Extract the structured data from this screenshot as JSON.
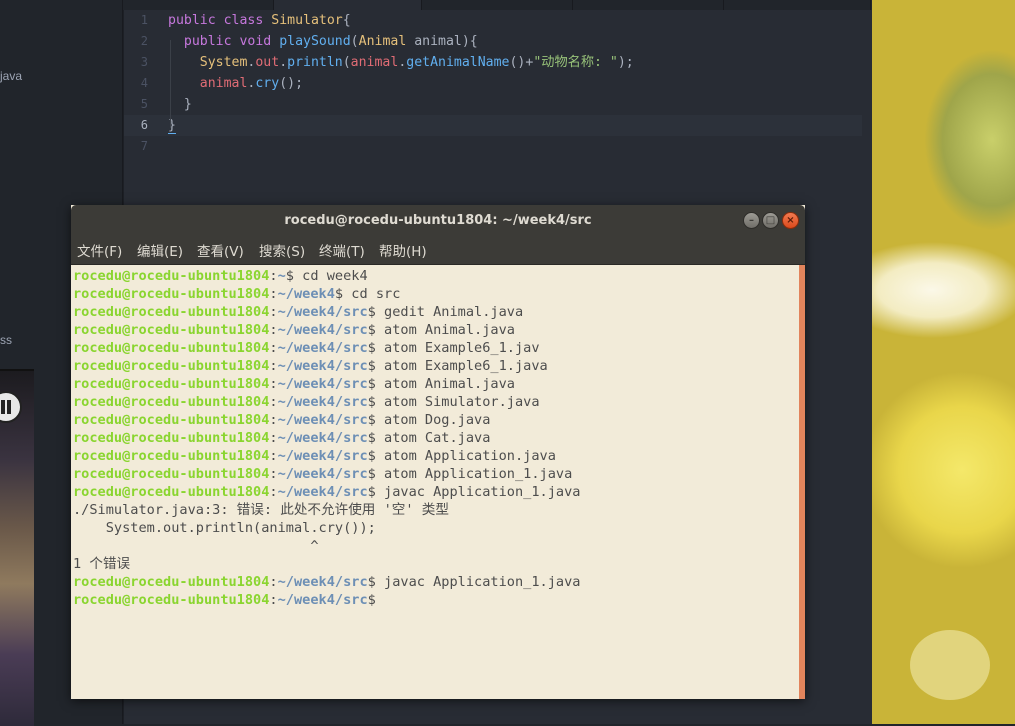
{
  "sidebar": {
    "items": [
      {
        "label": "java"
      },
      {
        "label": "ss"
      }
    ]
  },
  "editor": {
    "lines": [
      {
        "num": "1",
        "tokens": [
          [
            "kw",
            "public"
          ],
          [
            "pun",
            " "
          ],
          [
            "kw",
            "class"
          ],
          [
            "pun",
            " "
          ],
          [
            "cls",
            "Simulator"
          ],
          [
            "pun",
            "{"
          ]
        ]
      },
      {
        "num": "2",
        "tokens": [
          [
            "pun",
            "  "
          ],
          [
            "kw",
            "public"
          ],
          [
            "pun",
            " "
          ],
          [
            "kw",
            "void"
          ],
          [
            "pun",
            " "
          ],
          [
            "fn",
            "playSound"
          ],
          [
            "pun",
            "("
          ],
          [
            "cls",
            "Animal"
          ],
          [
            "pun",
            " animal){"
          ]
        ]
      },
      {
        "num": "3",
        "tokens": [
          [
            "pun",
            "    "
          ],
          [
            "cls",
            "System"
          ],
          [
            "pun",
            "."
          ],
          [
            "var",
            "out"
          ],
          [
            "pun",
            "."
          ],
          [
            "fn",
            "println"
          ],
          [
            "pun",
            "("
          ],
          [
            "var",
            "animal"
          ],
          [
            "pun",
            "."
          ],
          [
            "fn",
            "getAnimalName"
          ],
          [
            "pun",
            "()+"
          ],
          [
            "str",
            "\"动物名称: \""
          ],
          [
            "pun",
            ");"
          ]
        ]
      },
      {
        "num": "4",
        "tokens": [
          [
            "pun",
            "    "
          ],
          [
            "var",
            "animal"
          ],
          [
            "pun",
            "."
          ],
          [
            "fn",
            "cry"
          ],
          [
            "pun",
            "();"
          ]
        ]
      },
      {
        "num": "5",
        "tokens": [
          [
            "pun",
            "  }"
          ]
        ]
      },
      {
        "num": "6",
        "tokens": [
          [
            "brace",
            "}"
          ]
        ]
      },
      {
        "num": "7",
        "tokens": []
      }
    ]
  },
  "terminal": {
    "title": "rocedu@rocedu-ubuntu1804: ~/week4/src",
    "buttons": {
      "minimize": "–",
      "maximize": "□",
      "close": "×"
    },
    "menu": [
      "文件(F)",
      "编辑(E)",
      "查看(V)",
      "搜索(S)",
      "终端(T)",
      "帮助(H)"
    ],
    "lines": [
      {
        "user": "rocedu@rocedu-ubuntu1804",
        "path": "~",
        "cmd": " cd week4"
      },
      {
        "user": "rocedu@rocedu-ubuntu1804",
        "path": "~/week4",
        "cmd": " cd src"
      },
      {
        "user": "rocedu@rocedu-ubuntu1804",
        "path": "~/week4/src",
        "cmd": " gedit Animal.java"
      },
      {
        "user": "rocedu@rocedu-ubuntu1804",
        "path": "~/week4/src",
        "cmd": " atom Animal.java"
      },
      {
        "user": "rocedu@rocedu-ubuntu1804",
        "path": "~/week4/src",
        "cmd": " atom Example6_1.jav"
      },
      {
        "user": "rocedu@rocedu-ubuntu1804",
        "path": "~/week4/src",
        "cmd": " atom Example6_1.java"
      },
      {
        "user": "rocedu@rocedu-ubuntu1804",
        "path": "~/week4/src",
        "cmd": " atom Animal.java"
      },
      {
        "user": "rocedu@rocedu-ubuntu1804",
        "path": "~/week4/src",
        "cmd": " atom Simulator.java"
      },
      {
        "user": "rocedu@rocedu-ubuntu1804",
        "path": "~/week4/src",
        "cmd": " atom Dog.java"
      },
      {
        "user": "rocedu@rocedu-ubuntu1804",
        "path": "~/week4/src",
        "cmd": " atom Cat.java"
      },
      {
        "user": "rocedu@rocedu-ubuntu1804",
        "path": "~/week4/src",
        "cmd": " atom Application.java"
      },
      {
        "user": "rocedu@rocedu-ubuntu1804",
        "path": "~/week4/src",
        "cmd": " atom Application_1.java"
      },
      {
        "user": "rocedu@rocedu-ubuntu1804",
        "path": "~/week4/src",
        "cmd": " javac Application_1.java"
      },
      {
        "text": "./Simulator.java:3: 错误: 此处不允许使用 '空' 类型"
      },
      {
        "text": "    System.out.println(animal.cry());"
      },
      {
        "text": "                             ^"
      },
      {
        "text": "1 个错误"
      },
      {
        "user": "rocedu@rocedu-ubuntu1804",
        "path": "~/week4/src",
        "cmd": " javac Application_1.java"
      },
      {
        "user": "rocedu@rocedu-ubuntu1804",
        "path": "~/week4/src",
        "cmd": ""
      }
    ]
  },
  "colors": {
    "prompt_user": "#8ad52f",
    "prompt_path": "#6d8fb5",
    "terminal_bg": "#f2ebd9",
    "titlebar": "#3c3b37",
    "close_button": "#e05a2b",
    "editor_bg": "#282c34"
  }
}
